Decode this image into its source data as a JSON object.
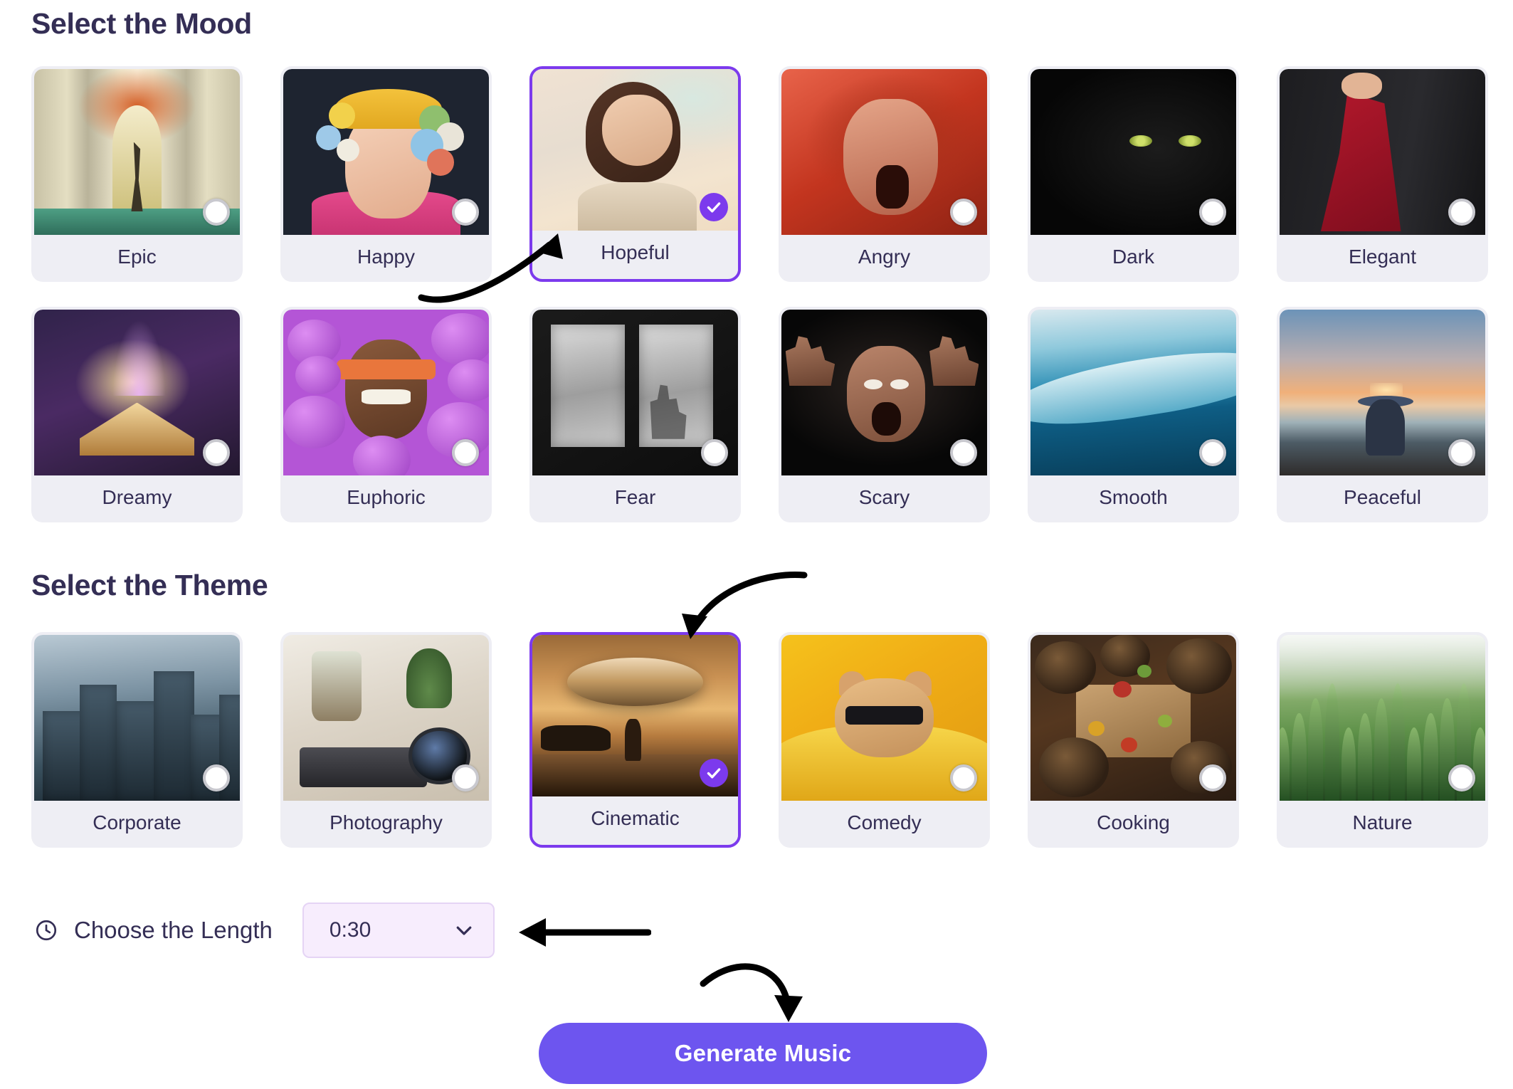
{
  "mood_section": {
    "title": "Select the Mood",
    "items": [
      {
        "label": "Epic",
        "selected": false,
        "art": "epic"
      },
      {
        "label": "Happy",
        "selected": false,
        "art": "happy"
      },
      {
        "label": "Hopeful",
        "selected": true,
        "art": "hopeful"
      },
      {
        "label": "Angry",
        "selected": false,
        "art": "angry"
      },
      {
        "label": "Dark",
        "selected": false,
        "art": "dark"
      },
      {
        "label": "Elegant",
        "selected": false,
        "art": "elegant"
      },
      {
        "label": "Dreamy",
        "selected": false,
        "art": "dreamy"
      },
      {
        "label": "Euphoric",
        "selected": false,
        "art": "euphoric"
      },
      {
        "label": "Fear",
        "selected": false,
        "art": "fear"
      },
      {
        "label": "Scary",
        "selected": false,
        "art": "scary"
      },
      {
        "label": "Smooth",
        "selected": false,
        "art": "smooth"
      },
      {
        "label": "Peaceful",
        "selected": false,
        "art": "peaceful"
      }
    ]
  },
  "theme_section": {
    "title": "Select the Theme",
    "items": [
      {
        "label": "Corporate",
        "selected": false,
        "art": "corporate"
      },
      {
        "label": "Photography",
        "selected": false,
        "art": "photography"
      },
      {
        "label": "Cinematic",
        "selected": true,
        "art": "cinematic"
      },
      {
        "label": "Comedy",
        "selected": false,
        "art": "comedy"
      },
      {
        "label": "Cooking",
        "selected": false,
        "art": "cooking"
      },
      {
        "label": "Nature",
        "selected": false,
        "art": "nature"
      }
    ]
  },
  "length": {
    "icon": "clock-icon",
    "label": "Choose the Length",
    "value": "0:30",
    "chevron": "chevron-down-icon"
  },
  "generate": {
    "label": "Generate Music"
  },
  "colors": {
    "accent_purple": "#7c3aed",
    "button_purple": "#6d55ef",
    "heading_navy": "#342e55",
    "label_bg": "#eeeef4",
    "select_bg": "#f7edfd",
    "select_border": "#e5d4f5",
    "page_bg": "#ffffff"
  },
  "annotations": [
    {
      "name": "arrow-to-hopeful-card",
      "style": "curved-arrow-up-right"
    },
    {
      "name": "arrow-to-cinematic-card",
      "style": "curved-arrow-down-left"
    },
    {
      "name": "arrow-to-length-select",
      "style": "straight-arrow-left"
    },
    {
      "name": "arrow-to-generate-button",
      "style": "curved-arrow-down-right"
    }
  ]
}
